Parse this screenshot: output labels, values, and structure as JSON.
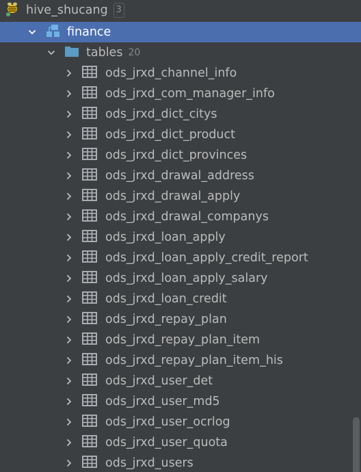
{
  "root": {
    "label": "hive_shucang",
    "badge": "3",
    "icon": "hive-bee-icon"
  },
  "schema": {
    "label": "finance",
    "icon": "schema-icon"
  },
  "folder": {
    "label": "tables",
    "count": "20",
    "icon": "folder-icon"
  },
  "tables": [
    "ods_jrxd_channel_info",
    "ods_jrxd_com_manager_info",
    "ods_jrxd_dict_citys",
    "ods_jrxd_dict_product",
    "ods_jrxd_dict_provinces",
    "ods_jrxd_drawal_address",
    "ods_jrxd_drawal_apply",
    "ods_jrxd_drawal_companys",
    "ods_jrxd_loan_apply",
    "ods_jrxd_loan_apply_credit_report",
    "ods_jrxd_loan_apply_salary",
    "ods_jrxd_loan_credit",
    "ods_jrxd_repay_plan",
    "ods_jrxd_repay_plan_item",
    "ods_jrxd_repay_plan_item_his",
    "ods_jrxd_user_det",
    "ods_jrxd_user_md5",
    "ods_jrxd_user_ocrlog",
    "ods_jrxd_user_quota",
    "ods_jrxd_users"
  ],
  "colors": {
    "background": "#3c3f41",
    "selection": "#4b6eaf",
    "text": "#bbbbbb",
    "folder": "#5b9bc4",
    "table_icon": "#b4b8bc"
  }
}
